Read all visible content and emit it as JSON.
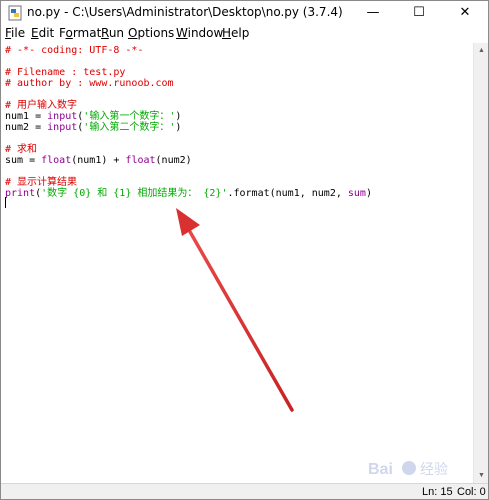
{
  "window": {
    "title": "no.py - C:\\Users\\Administrator\\Desktop\\no.py (3.7.4)",
    "minimize_glyph": "—",
    "maximize_glyph": "☐",
    "close_glyph": "✕"
  },
  "menu": [
    {
      "label": "File",
      "accel": "F"
    },
    {
      "label": "Edit",
      "accel": "E"
    },
    {
      "label": "Format",
      "accel": "o"
    },
    {
      "label": "Run",
      "accel": "R"
    },
    {
      "label": "Options",
      "accel": "O"
    },
    {
      "label": "Window",
      "accel": "W"
    },
    {
      "label": "Help",
      "accel": "H"
    }
  ],
  "code": {
    "l1": "# -*- coding: UTF-8 -*-",
    "l3": "# Filename : test.py",
    "l4": "# author by : www.runoob.com",
    "l6": "# 用户输入数字",
    "l7": {
      "a": "num1 = ",
      "b": "input",
      "c": "(",
      "d": "'输入第一个数字：'",
      "e": ")"
    },
    "l8": {
      "a": "num2 = ",
      "b": "input",
      "c": "(",
      "d": "'输入第二个数字：'",
      "e": ")"
    },
    "l10": "# 求和",
    "l11": {
      "a": "sum = ",
      "b": "float",
      "c": "(num1) + ",
      "d": "float",
      "e": "(num2)"
    },
    "l13": "# 显示计算结果",
    "l14": {
      "a": "print",
      "b": "(",
      "c": "'数字 {0} 和 {1} 相加结果为： {2}'",
      "d": ".format(num1, num2, ",
      "e": "sum",
      "f": ")"
    }
  },
  "status": {
    "line": "Ln: 15",
    "col": "Col: 0"
  },
  "watermark": "Bai 经验",
  "scroll": {
    "up_glyph": "▲",
    "down_glyph": "▼"
  },
  "colors": {
    "comment": "#dd0000",
    "builtin": "#900090",
    "string": "#00aa00",
    "annotation_arrow": "#e03a3a"
  }
}
